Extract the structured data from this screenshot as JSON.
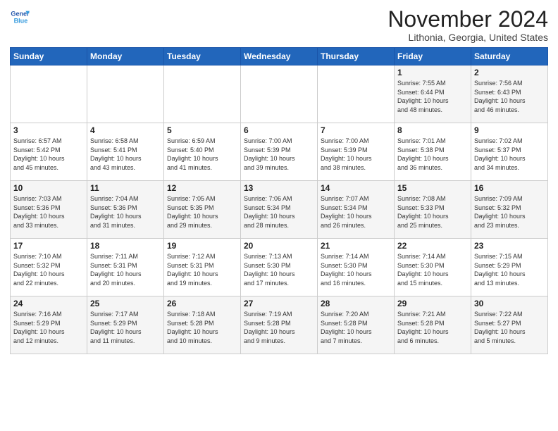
{
  "header": {
    "logo_line1": "General",
    "logo_line2": "Blue",
    "month": "November 2024",
    "location": "Lithonia, Georgia, United States"
  },
  "weekdays": [
    "Sunday",
    "Monday",
    "Tuesday",
    "Wednesday",
    "Thursday",
    "Friday",
    "Saturday"
  ],
  "weeks": [
    [
      {
        "day": "",
        "info": ""
      },
      {
        "day": "",
        "info": ""
      },
      {
        "day": "",
        "info": ""
      },
      {
        "day": "",
        "info": ""
      },
      {
        "day": "",
        "info": ""
      },
      {
        "day": "1",
        "info": "Sunrise: 7:55 AM\nSunset: 6:44 PM\nDaylight: 10 hours\nand 48 minutes."
      },
      {
        "day": "2",
        "info": "Sunrise: 7:56 AM\nSunset: 6:43 PM\nDaylight: 10 hours\nand 46 minutes."
      }
    ],
    [
      {
        "day": "3",
        "info": "Sunrise: 6:57 AM\nSunset: 5:42 PM\nDaylight: 10 hours\nand 45 minutes."
      },
      {
        "day": "4",
        "info": "Sunrise: 6:58 AM\nSunset: 5:41 PM\nDaylight: 10 hours\nand 43 minutes."
      },
      {
        "day": "5",
        "info": "Sunrise: 6:59 AM\nSunset: 5:40 PM\nDaylight: 10 hours\nand 41 minutes."
      },
      {
        "day": "6",
        "info": "Sunrise: 7:00 AM\nSunset: 5:39 PM\nDaylight: 10 hours\nand 39 minutes."
      },
      {
        "day": "7",
        "info": "Sunrise: 7:00 AM\nSunset: 5:39 PM\nDaylight: 10 hours\nand 38 minutes."
      },
      {
        "day": "8",
        "info": "Sunrise: 7:01 AM\nSunset: 5:38 PM\nDaylight: 10 hours\nand 36 minutes."
      },
      {
        "day": "9",
        "info": "Sunrise: 7:02 AM\nSunset: 5:37 PM\nDaylight: 10 hours\nand 34 minutes."
      }
    ],
    [
      {
        "day": "10",
        "info": "Sunrise: 7:03 AM\nSunset: 5:36 PM\nDaylight: 10 hours\nand 33 minutes."
      },
      {
        "day": "11",
        "info": "Sunrise: 7:04 AM\nSunset: 5:36 PM\nDaylight: 10 hours\nand 31 minutes."
      },
      {
        "day": "12",
        "info": "Sunrise: 7:05 AM\nSunset: 5:35 PM\nDaylight: 10 hours\nand 29 minutes."
      },
      {
        "day": "13",
        "info": "Sunrise: 7:06 AM\nSunset: 5:34 PM\nDaylight: 10 hours\nand 28 minutes."
      },
      {
        "day": "14",
        "info": "Sunrise: 7:07 AM\nSunset: 5:34 PM\nDaylight: 10 hours\nand 26 minutes."
      },
      {
        "day": "15",
        "info": "Sunrise: 7:08 AM\nSunset: 5:33 PM\nDaylight: 10 hours\nand 25 minutes."
      },
      {
        "day": "16",
        "info": "Sunrise: 7:09 AM\nSunset: 5:32 PM\nDaylight: 10 hours\nand 23 minutes."
      }
    ],
    [
      {
        "day": "17",
        "info": "Sunrise: 7:10 AM\nSunset: 5:32 PM\nDaylight: 10 hours\nand 22 minutes."
      },
      {
        "day": "18",
        "info": "Sunrise: 7:11 AM\nSunset: 5:31 PM\nDaylight: 10 hours\nand 20 minutes."
      },
      {
        "day": "19",
        "info": "Sunrise: 7:12 AM\nSunset: 5:31 PM\nDaylight: 10 hours\nand 19 minutes."
      },
      {
        "day": "20",
        "info": "Sunrise: 7:13 AM\nSunset: 5:30 PM\nDaylight: 10 hours\nand 17 minutes."
      },
      {
        "day": "21",
        "info": "Sunrise: 7:14 AM\nSunset: 5:30 PM\nDaylight: 10 hours\nand 16 minutes."
      },
      {
        "day": "22",
        "info": "Sunrise: 7:14 AM\nSunset: 5:30 PM\nDaylight: 10 hours\nand 15 minutes."
      },
      {
        "day": "23",
        "info": "Sunrise: 7:15 AM\nSunset: 5:29 PM\nDaylight: 10 hours\nand 13 minutes."
      }
    ],
    [
      {
        "day": "24",
        "info": "Sunrise: 7:16 AM\nSunset: 5:29 PM\nDaylight: 10 hours\nand 12 minutes."
      },
      {
        "day": "25",
        "info": "Sunrise: 7:17 AM\nSunset: 5:29 PM\nDaylight: 10 hours\nand 11 minutes."
      },
      {
        "day": "26",
        "info": "Sunrise: 7:18 AM\nSunset: 5:28 PM\nDaylight: 10 hours\nand 10 minutes."
      },
      {
        "day": "27",
        "info": "Sunrise: 7:19 AM\nSunset: 5:28 PM\nDaylight: 10 hours\nand 9 minutes."
      },
      {
        "day": "28",
        "info": "Sunrise: 7:20 AM\nSunset: 5:28 PM\nDaylight: 10 hours\nand 7 minutes."
      },
      {
        "day": "29",
        "info": "Sunrise: 7:21 AM\nSunset: 5:28 PM\nDaylight: 10 hours\nand 6 minutes."
      },
      {
        "day": "30",
        "info": "Sunrise: 7:22 AM\nSunset: 5:27 PM\nDaylight: 10 hours\nand 5 minutes."
      }
    ]
  ]
}
